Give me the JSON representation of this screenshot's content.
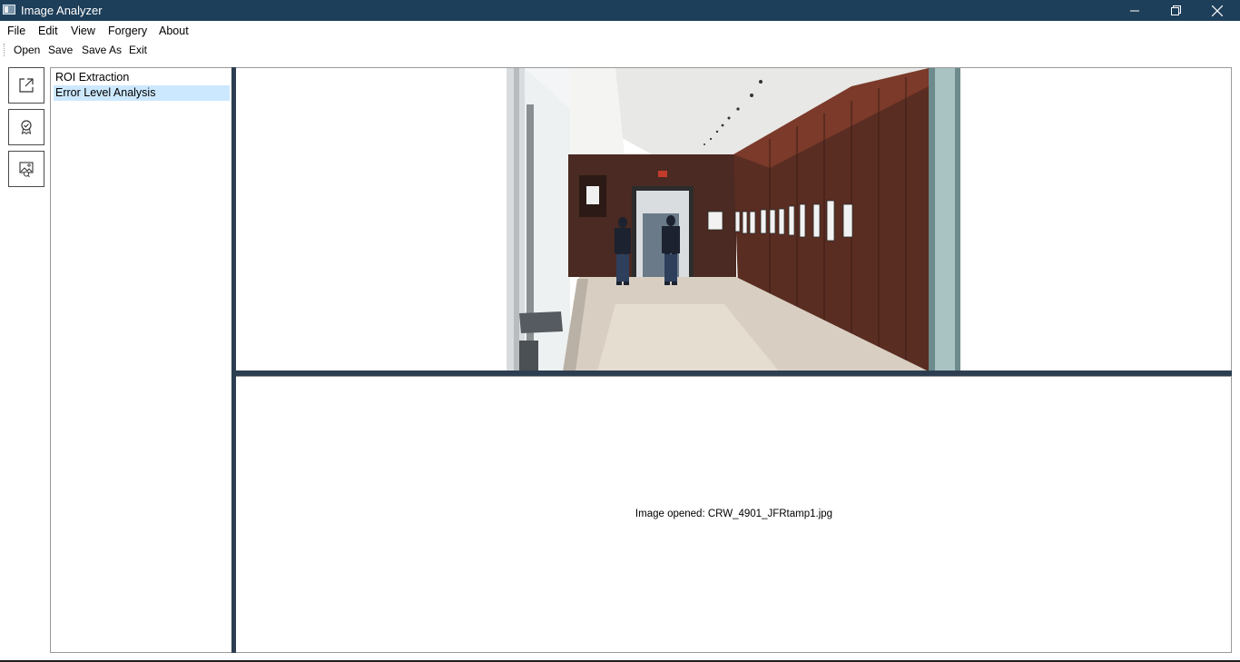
{
  "window": {
    "title": "Image Analyzer"
  },
  "menu": [
    "File",
    "Edit",
    "View",
    "Forgery",
    "About"
  ],
  "toolbar": [
    "Open",
    "Save",
    "Save As",
    "Exit"
  ],
  "tools": {
    "items": [
      {
        "label": "ROI Extraction",
        "selected": false
      },
      {
        "label": "Error Level Analysis",
        "selected": true
      }
    ]
  },
  "sidebar_icons": [
    "export-icon",
    "badge-icon",
    "image-icon"
  ],
  "status": {
    "message": "Image opened: CRW_4901_JFRtamp1.jpg"
  },
  "colors": {
    "titlebar": "#1e3f5a",
    "selection": "#cce8ff",
    "splitter": "#2c3e50"
  }
}
